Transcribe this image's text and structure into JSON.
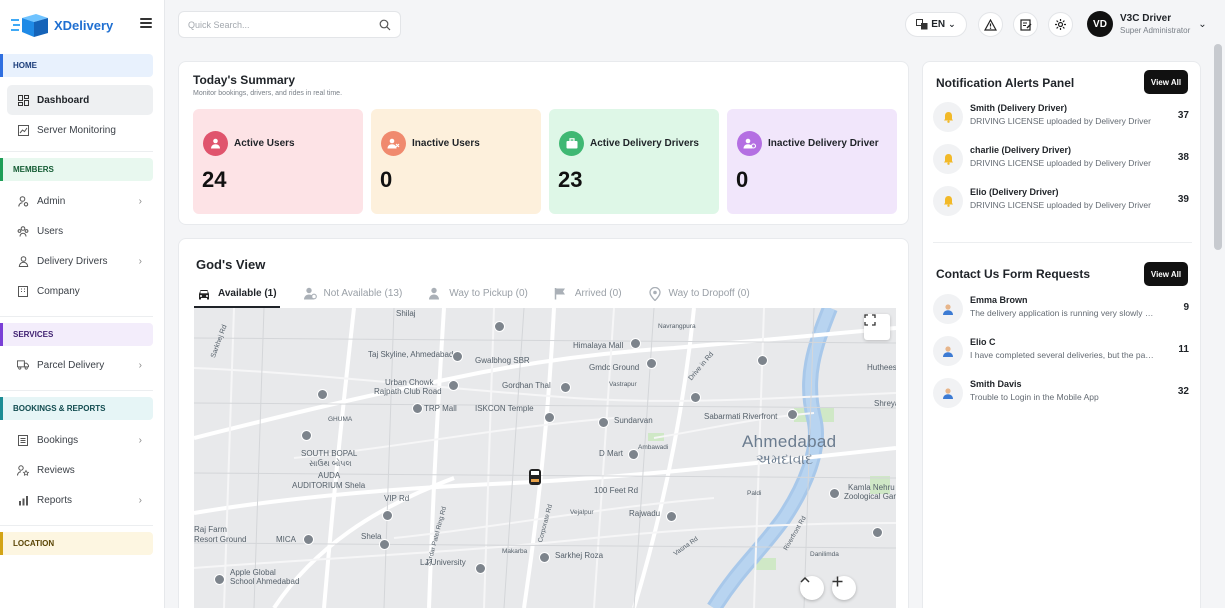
{
  "brand": {
    "name": "XDelivery"
  },
  "sidebar": {
    "sections": [
      {
        "label": "HOME"
      },
      {
        "label": "MEMBERS"
      },
      {
        "label": "SERVICES"
      },
      {
        "label": "BOOKINGS & REPORTS"
      },
      {
        "label": "LOCATION"
      }
    ],
    "items": [
      {
        "label": "Dashboard"
      },
      {
        "label": "Server Monitoring"
      },
      {
        "label": "Admin"
      },
      {
        "label": "Users"
      },
      {
        "label": "Delivery Drivers"
      },
      {
        "label": "Company"
      },
      {
        "label": "Parcel Delivery"
      },
      {
        "label": "Bookings"
      },
      {
        "label": "Reviews"
      },
      {
        "label": "Reports"
      }
    ]
  },
  "search": {
    "placeholder": "Quick Search..."
  },
  "header": {
    "language": "EN",
    "user_initials": "VD",
    "user_name": "V3C Driver",
    "user_role": "Super Administrator"
  },
  "summary": {
    "title": "Today's Summary",
    "subtitle": "Monitor bookings, drivers, and rides in real time.",
    "stats": [
      {
        "label": "Active Users",
        "value": "24",
        "bg": "#fde3e6",
        "icon_bg": "#e0546d",
        "icon": "user-icon"
      },
      {
        "label": "Inactive Users",
        "value": "0",
        "bg": "#fdf0dc",
        "icon_bg": "#f08a6e",
        "icon": "user-remove-icon"
      },
      {
        "label": "Active Delivery Drivers",
        "value": "23",
        "bg": "#def7e7",
        "icon_bg": "#3fb873",
        "icon": "briefcase-icon"
      },
      {
        "label": "Inactive Delivery Driver",
        "value": "0",
        "bg": "#f1e6fb",
        "icon_bg": "#b46fe2",
        "icon": "user-off-icon"
      }
    ]
  },
  "gods_view": {
    "title": "God's View",
    "tabs": [
      {
        "label": "Available (1)"
      },
      {
        "label": "Not Available (13)"
      },
      {
        "label": "Way to Pickup (0)"
      },
      {
        "label": "Arrived (0)"
      },
      {
        "label": "Way to Dropoff (0)"
      }
    ],
    "map_labels": [
      "Shilaj",
      "Taj Skyline, Ahmedabad",
      "Gwalbhog SBR",
      "Himalaya Mall",
      "Gmdc Ground",
      "Urban Chowk",
      "Rajpath Club Road",
      "Gordhan Thal",
      "TRP Mall",
      "ISKCON Temple",
      "Sundarvan",
      "Sabarmati Riverfront",
      "Ahmedabad",
      "અમદાવાદ",
      "SOUTH BOPAL",
      "સાઉથ બોપલ",
      "AUDA",
      "AUDITORIUM Shela",
      "VIP Rd",
      "D Mart",
      "100 Feet Rd",
      "Rajwadu",
      "Raj Farm",
      "Resort Ground",
      "MICA",
      "Shela",
      "LJ University",
      "Sarkhej Roza",
      "Apple Global",
      "School Ahmedabad",
      "Hutheesing",
      "Shreyas",
      "Kamla Nehru",
      "Zoological Garden",
      "Sarkhej Rd",
      "Drive in Rd",
      "Vastrapur",
      "Navrangpura",
      "Ambawadi",
      "Vejalpur",
      "Makarba",
      "Paldi",
      "Danilimda",
      "GHUMA",
      "Sardar Patel Ring Rd",
      "Corporate Rd",
      "Vasna Rd",
      "Riverfront Rd"
    ]
  },
  "notifications": {
    "title": "Notification Alerts Panel",
    "view_all": "View All",
    "items": [
      {
        "title": "Smith (Delivery Driver)",
        "desc": "DRIVING LICENSE uploaded by Delivery Driver",
        "count": "37"
      },
      {
        "title": "charlie (Delivery Driver)",
        "desc": "DRIVING LICENSE uploaded by Delivery Driver",
        "count": "38"
      },
      {
        "title": "Elio (Delivery Driver)",
        "desc": "DRIVING LICENSE uploaded by Delivery Driver",
        "count": "39"
      }
    ]
  },
  "contact": {
    "title": "Contact Us Form Requests",
    "view_all": "View All",
    "items": [
      {
        "title": "Emma Brown",
        "desc": "The delivery application is running very slowly and f...",
        "count": "9"
      },
      {
        "title": "Elio C",
        "desc": "I have completed several deliveries, but the payme...",
        "count": "11"
      },
      {
        "title": "Smith Davis",
        "desc": "Trouble to Login in the Mobile App",
        "count": "32"
      }
    ]
  }
}
